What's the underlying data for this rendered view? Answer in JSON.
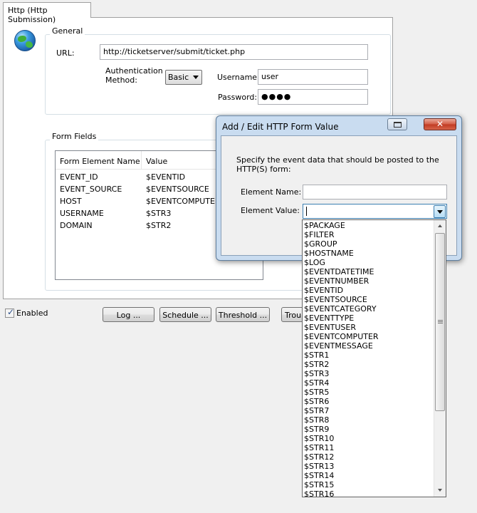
{
  "tab": {
    "label": "Http (Http Submission)"
  },
  "general": {
    "title": "General",
    "url_label": "URL:",
    "url_value": "http://ticketserver/submit/ticket.php",
    "auth_label_line1": "Authentication",
    "auth_label_line2": "Method:",
    "auth_value": "Basic",
    "username_label": "Username:",
    "username_value": "user",
    "password_label": "Password:",
    "password_value": "●●●●"
  },
  "form_fields": {
    "title": "Form Fields",
    "columns": [
      "Form Element Name",
      "Value"
    ],
    "rows": [
      {
        "name": "EVENT_ID",
        "value": "$EVENTID"
      },
      {
        "name": "EVENT_SOURCE",
        "value": "$EVENTSOURCE"
      },
      {
        "name": "HOST",
        "value": "$EVENTCOMPUTER"
      },
      {
        "name": "USERNAME",
        "value": "$STR3"
      },
      {
        "name": "DOMAIN",
        "value": "$STR2"
      }
    ]
  },
  "bottom": {
    "enabled_label": "Enabled",
    "enabled_checked": true,
    "log_button": "Log ...",
    "schedule_button": "Schedule ...",
    "threshold_button": "Threshold ...",
    "troubleshoot_button": "Troub"
  },
  "dialog": {
    "title": "Add / Edit HTTP Form Value",
    "close_glyph": "✕",
    "description": "Specify the event data that should be posted to the HTTP(S) form:",
    "element_name_label": "Element Name:",
    "element_name_value": "",
    "element_value_label": "Element Value:",
    "element_value_value": "",
    "options": [
      "$PACKAGE",
      "$FILTER",
      "$GROUP",
      "$HOSTNAME",
      "$LOG",
      "$EVENTDATETIME",
      "$EVENTNUMBER",
      "$EVENTID",
      "$EVENTSOURCE",
      "$EVENTCATEGORY",
      "$EVENTTYPE",
      "$EVENTUSER",
      "$EVENTCOMPUTER",
      "$EVENTMESSAGE",
      "$STR1",
      "$STR2",
      "$STR3",
      "$STR4",
      "$STR5",
      "$STR6",
      "$STR7",
      "$STR8",
      "$STR9",
      "$STR10",
      "$STR11",
      "$STR12",
      "$STR13",
      "$STR14",
      "$STR15",
      "$STR16"
    ]
  }
}
